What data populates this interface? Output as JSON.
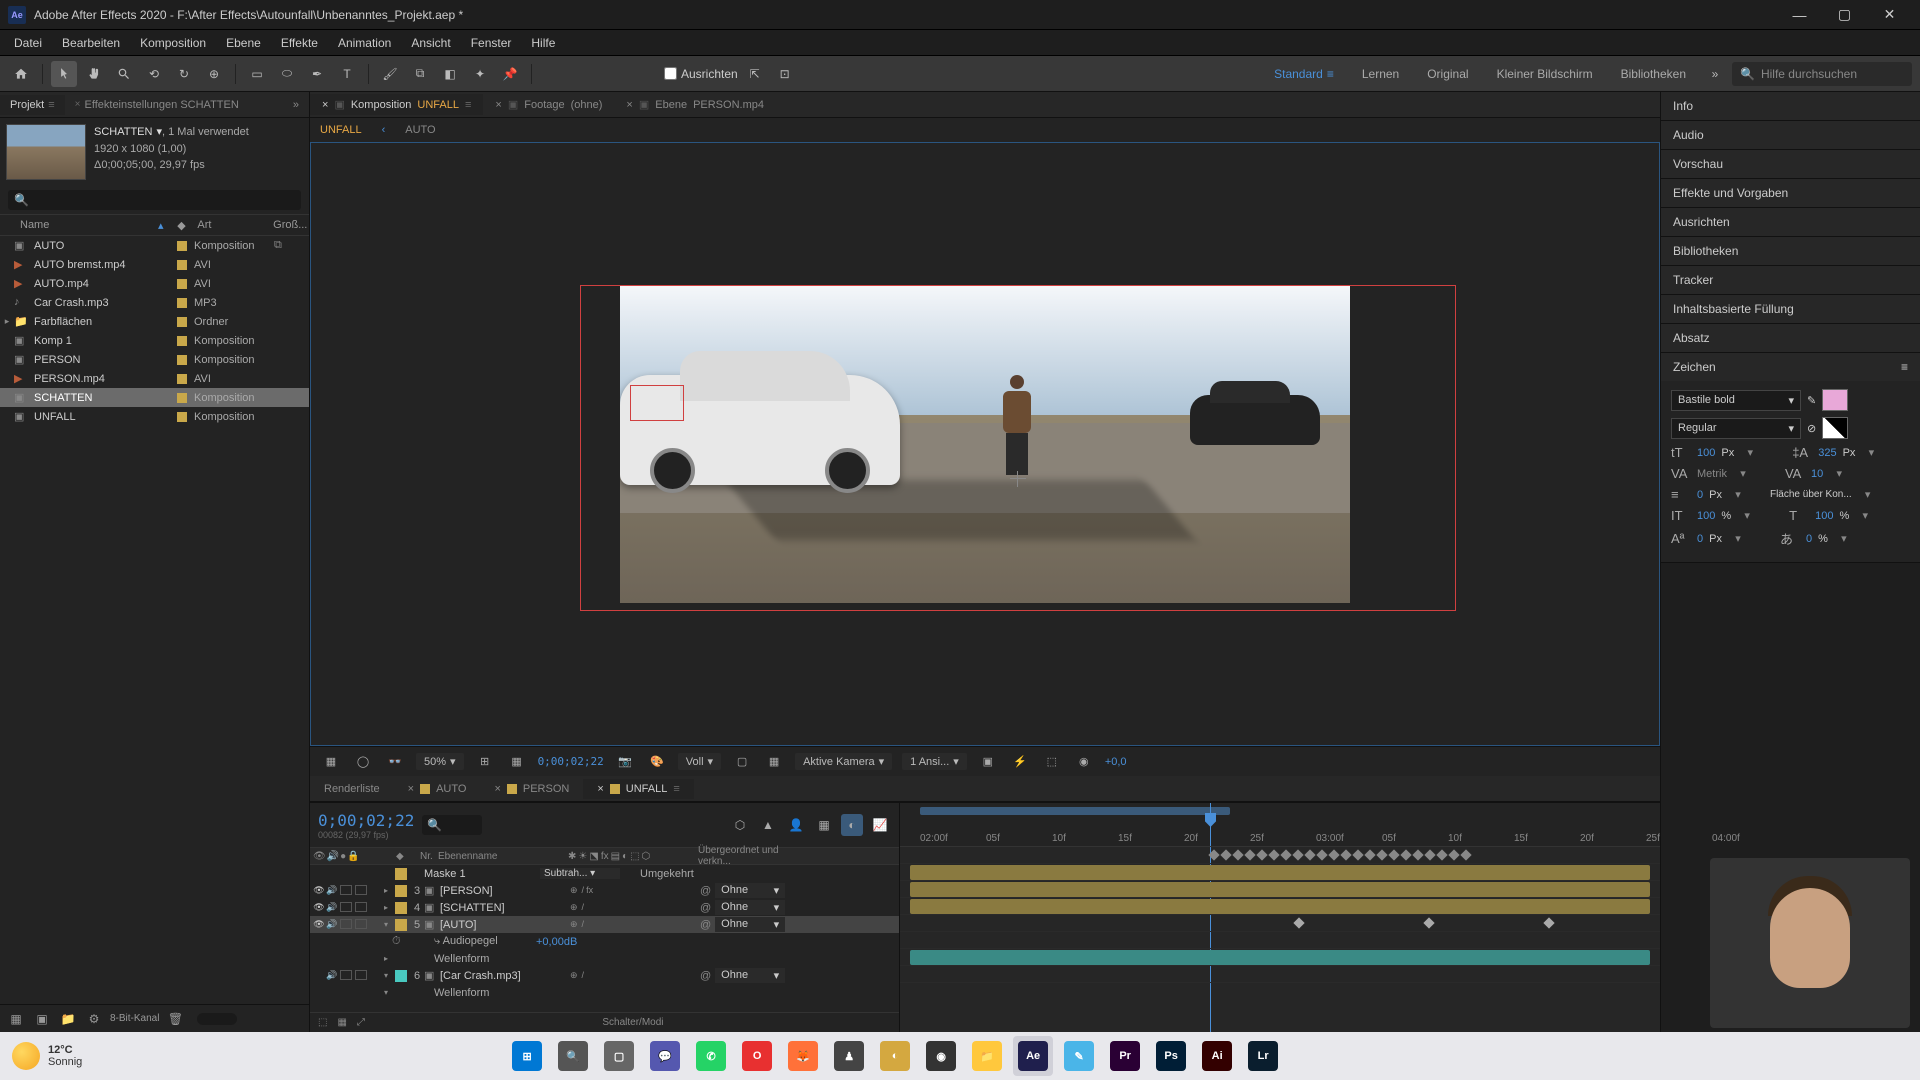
{
  "window": {
    "title": "Adobe After Effects 2020 - F:\\After Effects\\Autounfall\\Unbenanntes_Projekt.aep *"
  },
  "menu": [
    "Datei",
    "Bearbeiten",
    "Komposition",
    "Ebene",
    "Effekte",
    "Animation",
    "Ansicht",
    "Fenster",
    "Hilfe"
  ],
  "toolbar": {
    "snap": "Ausrichten",
    "workspaces": [
      "Standard",
      "Lernen",
      "Original",
      "Kleiner Bildschirm",
      "Bibliotheken"
    ],
    "search_placeholder": "Hilfe durchsuchen"
  },
  "project": {
    "tab_project": "Projekt",
    "tab_effects": "Effekteinstellungen SCHATTEN",
    "selected": {
      "name": "SCHATTEN",
      "usage": ", 1 Mal verwendet",
      "res": "1920 x 1080 (1,00)",
      "dur": "Δ0;00;05;00, 29,97 fps"
    },
    "cols": {
      "name": "Name",
      "type": "Art",
      "size": "Groß..."
    },
    "items": [
      {
        "name": "AUTO",
        "type": "Komposition",
        "color": "#c9a84a",
        "icon": "comp",
        "link": true
      },
      {
        "name": "AUTO bremst.mp4",
        "type": "AVI",
        "color": "#c9a84a",
        "icon": "video"
      },
      {
        "name": "AUTO.mp4",
        "type": "AVI",
        "color": "#c9a84a",
        "icon": "video"
      },
      {
        "name": "Car Crash.mp3",
        "type": "MP3",
        "color": "#c9a84a",
        "icon": "audio"
      },
      {
        "name": "Farbflächen",
        "type": "Ordner",
        "color": "#c9a84a",
        "icon": "folder",
        "expandable": true
      },
      {
        "name": "Komp 1",
        "type": "Komposition",
        "color": "#c9a84a",
        "icon": "comp"
      },
      {
        "name": "PERSON",
        "type": "Komposition",
        "color": "#c9a84a",
        "icon": "comp"
      },
      {
        "name": "PERSON.mp4",
        "type": "AVI",
        "color": "#c9a84a",
        "icon": "video"
      },
      {
        "name": "SCHATTEN",
        "type": "Komposition",
        "color": "#c9a84a",
        "icon": "comp",
        "selected": true
      },
      {
        "name": "UNFALL",
        "type": "Komposition",
        "color": "#c9a84a",
        "icon": "comp"
      }
    ],
    "footer_depth": "8-Bit-Kanal"
  },
  "composition": {
    "tabs": [
      {
        "prefix": "Komposition",
        "name": "UNFALL",
        "active": true,
        "flow": true
      },
      {
        "prefix": "Footage",
        "name": "(ohne)"
      },
      {
        "prefix": "Ebene",
        "name": "PERSON.mp4"
      }
    ],
    "subtabs": [
      {
        "name": "UNFALL",
        "active": true,
        "arrow": true
      },
      {
        "name": "AUTO"
      }
    ],
    "controls": {
      "zoom": "50%",
      "timecode": "0;00;02;22",
      "res": "Voll",
      "camera": "Aktive Kamera",
      "views": "1 Ansi...",
      "exposure": "+0,0"
    }
  },
  "right": {
    "panels": [
      "Info",
      "Audio",
      "Vorschau",
      "Effekte und Vorgaben",
      "Ausrichten",
      "Bibliotheken",
      "Tracker",
      "Inhaltsbasierte Füllung",
      "Absatz"
    ],
    "char_title": "Zeichen",
    "char": {
      "font": "Bastile bold",
      "style": "Regular",
      "size": "100",
      "size_unit": "Px",
      "leading": "325",
      "leading_unit": "Px",
      "kerning": "Metrik",
      "tracking": "10",
      "stroke": "0",
      "stroke_unit": "Px",
      "stroke_mode": "Fläche über Kon...",
      "vscale": "100",
      "vscale_unit": "%",
      "hscale": "100",
      "hscale_unit": "%",
      "baseline": "0",
      "baseline_unit": "Px",
      "tsume": "0",
      "tsume_unit": "%"
    }
  },
  "timeline": {
    "tabs": [
      {
        "name": "Renderliste"
      },
      {
        "name": "AUTO",
        "color": "#c9a84a"
      },
      {
        "name": "PERSON",
        "color": "#c9a84a"
      },
      {
        "name": "UNFALL",
        "color": "#c9a84a",
        "active": true,
        "flow": true
      }
    ],
    "time": "0;00;02;22",
    "frame": "00082 (29,97 fps)",
    "cols": {
      "nr": "Nr.",
      "name": "Ebenenname",
      "parent": "Übergeordnet und verkn..."
    },
    "layers": [
      {
        "type": "mask",
        "name": "Maske 1",
        "mode": "Subtrah...",
        "inv": "Umgekehrt",
        "indent": 1,
        "color": "#c9a84a"
      },
      {
        "num": "3",
        "name": "[PERSON]",
        "parent": "Ohne",
        "color": "#c9a84a",
        "fx": true
      },
      {
        "num": "4",
        "name": "[SCHATTEN]",
        "parent": "Ohne",
        "color": "#c9a84a"
      },
      {
        "num": "5",
        "name": "[AUTO]",
        "parent": "Ohne",
        "color": "#c9a84a",
        "selected": true,
        "expanded": true
      },
      {
        "type": "prop",
        "name": "Audiopegel",
        "value": "+0,00dB",
        "indent": 2,
        "stopwatch": true
      },
      {
        "type": "prop",
        "name": "Wellenform",
        "indent": 2,
        "expandable": true
      },
      {
        "num": "6",
        "name": "[Car Crash.mp3]",
        "parent": "Ohne",
        "color": "#49c9c0",
        "audio_only": true,
        "expanded": true
      },
      {
        "type": "prop",
        "name": "Wellenform",
        "indent": 2,
        "expandable": true,
        "open": true
      }
    ],
    "footer": "Schalter/Modi",
    "ruler": [
      "02:00f",
      "05f",
      "10f",
      "15f",
      "20f",
      "25f",
      "03:00f",
      "05f",
      "10f",
      "15f",
      "20f",
      "25f",
      "04:00f"
    ]
  },
  "taskbar": {
    "temp": "12°C",
    "cond": "Sonnig",
    "apps": [
      {
        "name": "start",
        "bg": "#0078d4",
        "txt": "⊞"
      },
      {
        "name": "search",
        "bg": "#555",
        "txt": "🔍"
      },
      {
        "name": "taskview",
        "bg": "#666",
        "txt": "▢"
      },
      {
        "name": "teams",
        "bg": "#5558af",
        "txt": "💬"
      },
      {
        "name": "whatsapp",
        "bg": "#25d366",
        "txt": "✆"
      },
      {
        "name": "opera",
        "bg": "#e83030",
        "txt": "O"
      },
      {
        "name": "firefox",
        "bg": "#ff7139",
        "txt": "🦊"
      },
      {
        "name": "app1",
        "bg": "#444",
        "txt": "♟"
      },
      {
        "name": "app2",
        "bg": "#d4a840",
        "txt": "◐"
      },
      {
        "name": "obs",
        "bg": "#333",
        "txt": "◉"
      },
      {
        "name": "explorer",
        "bg": "#ffc83d",
        "txt": "📁"
      },
      {
        "name": "ae",
        "bg": "#1f1f4d",
        "txt": "Ae",
        "active": true
      },
      {
        "name": "notes",
        "bg": "#4ab5e8",
        "txt": "✎"
      },
      {
        "name": "pr",
        "bg": "#2a0034",
        "txt": "Pr"
      },
      {
        "name": "ps",
        "bg": "#001e36",
        "txt": "Ps"
      },
      {
        "name": "ai",
        "bg": "#330000",
        "txt": "Ai"
      },
      {
        "name": "lr",
        "bg": "#0a1e2e",
        "txt": "Lr"
      }
    ]
  }
}
